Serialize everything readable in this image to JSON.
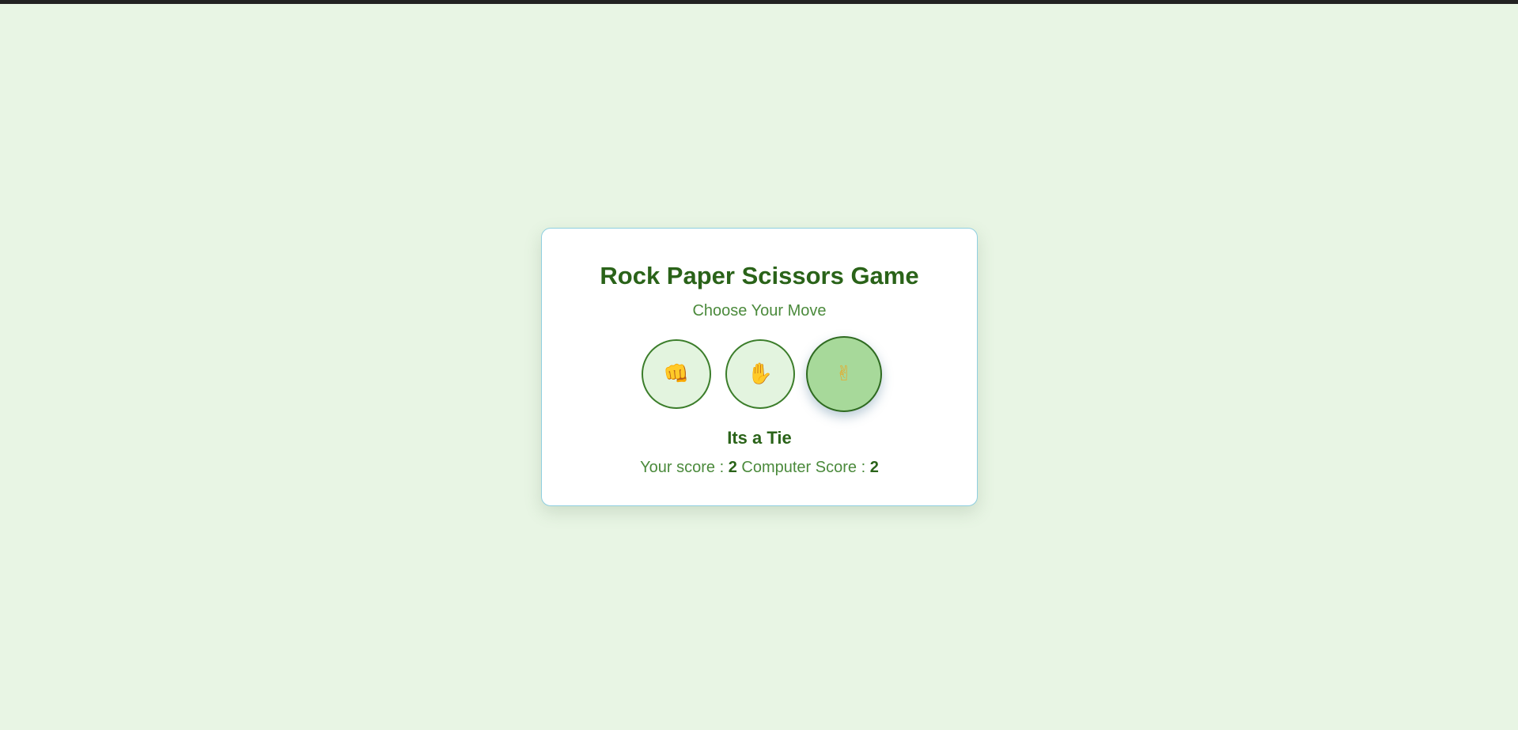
{
  "game": {
    "title": "Rock Paper Scissors Game",
    "prompt": "Choose Your Move",
    "choices": [
      {
        "name": "rock",
        "glyph": "👊",
        "selected": false
      },
      {
        "name": "paper",
        "glyph": "✋",
        "selected": false
      },
      {
        "name": "scissors",
        "glyph": "✌",
        "selected": true
      }
    ],
    "result": "Its a Tie",
    "score": {
      "user_label": "Your score : ",
      "user_value": "2",
      "computer_label": " Computer Score : ",
      "computer_value": "2"
    }
  },
  "colors": {
    "background": "#e8f5e4",
    "accent": "#2a6319",
    "selected": "#a7d99a"
  }
}
